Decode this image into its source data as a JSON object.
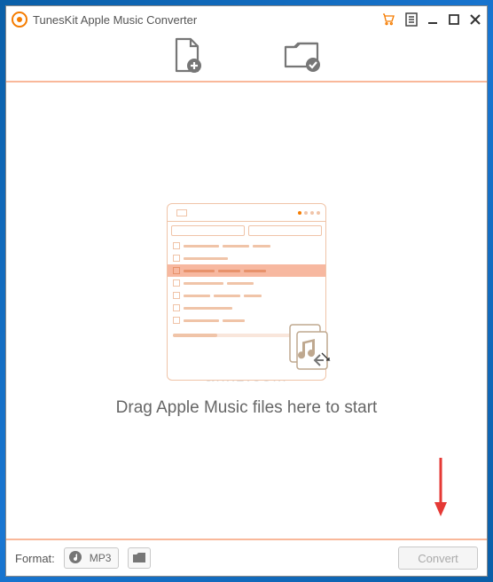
{
  "titlebar": {
    "app_title": "TunesKit Apple Music Converter"
  },
  "main": {
    "hint_text": "Drag Apple Music files here to start"
  },
  "watermark": {
    "line1": "安下载",
    "line2": "anxz.com"
  },
  "bottombar": {
    "format_label": "Format:",
    "format_value": "MP3",
    "convert_label": "Convert"
  },
  "icons": {
    "logo": "app-logo",
    "cart": "shopping-cart-icon",
    "menu": "menu-icon",
    "minimize": "minimize-icon",
    "maximize": "maximize-icon",
    "close": "close-icon",
    "add_file": "add-file-icon",
    "output_folder": "output-folder-icon",
    "music_format": "music-format-icon",
    "browse_folder": "folder-icon"
  }
}
